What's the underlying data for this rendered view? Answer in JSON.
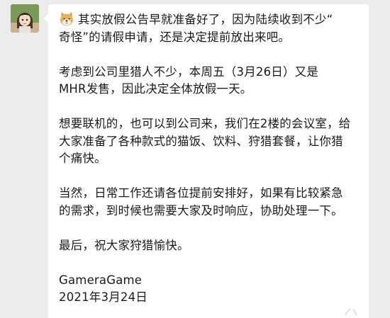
{
  "message": {
    "emoji_icon": "doge-emoji-icon",
    "paragraphs": [
      "其实放假公告早就准备好了，因为陆续收到不少“\n奇怪”的请假申请，还是决定提前放出来吧。",
      "考虑到公司里猎人不少，本周五（3月26日）又是\nMHR发售，因此决定全体放假一天。",
      "想要联机的，也可以到公司来，我们在2楼的会议室，给\n大家准备了各种款式的猫饭、饮料、狩猎套餐，让你猎\n个痛快。",
      "当然，日常工作还请各位提前安排好，如果有比较紧急\n的需求，到时候也需要大家及时响应，协助处理一下。",
      "最后，祝大家狩猎愉快。"
    ],
    "signature_name": "GameraGame",
    "signature_date": "2021年3月24日"
  },
  "colors": {
    "background": "#ececec",
    "bubble": "#ffffff",
    "text": "#1a1a1a"
  }
}
